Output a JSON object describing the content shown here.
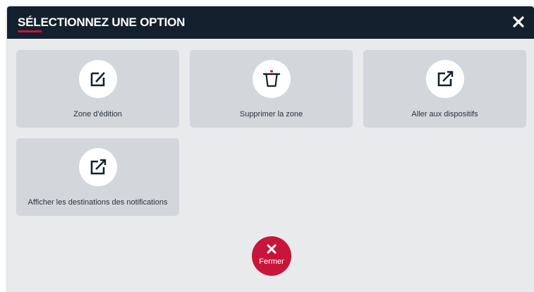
{
  "modal": {
    "title": "SÉLECTIONNEZ UNE OPTION",
    "close_icon": "close-icon"
  },
  "options": [
    {
      "label": "Zone d'édition",
      "icon": "edit-icon"
    },
    {
      "label": "Supprimer la zone",
      "icon": "trash-icon"
    },
    {
      "label": "Aller aux dispositifs",
      "icon": "external-link-icon"
    },
    {
      "label": "Afficher les destinations des notifications",
      "icon": "external-link-icon"
    }
  ],
  "footer": {
    "close_label": "Fermer",
    "close_icon": "close-icon"
  },
  "colors": {
    "header_bg": "#15202e",
    "accent": "#c8163b",
    "panel_bg": "#e9eaec",
    "tile_bg": "#d3d6db",
    "icon_color": "#15202e"
  }
}
